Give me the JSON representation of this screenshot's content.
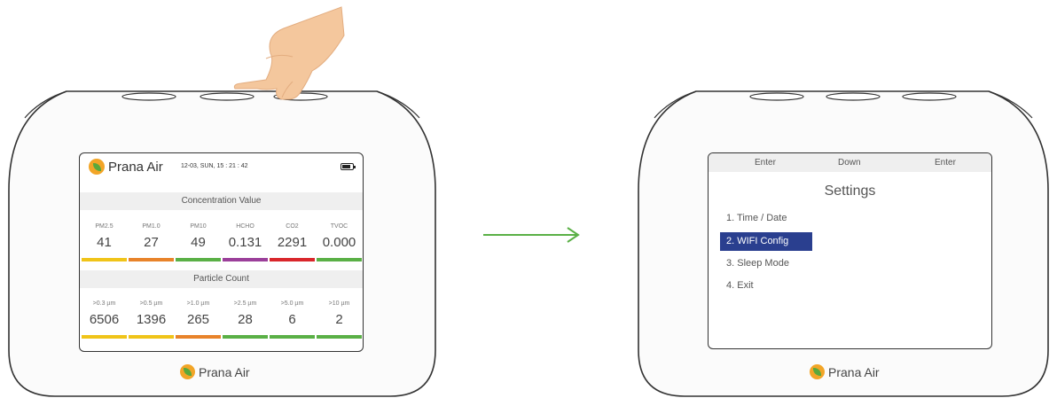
{
  "left_device": {
    "brand": "Prana Air",
    "datetime": "12-03, SUN, 15 : 21 : 42",
    "concentration_title": "Concentration Value",
    "concentration": [
      {
        "label": "PM2.5",
        "value": "41",
        "color": "#f0c419"
      },
      {
        "label": "PM1.0",
        "value": "27",
        "color": "#e8832a"
      },
      {
        "label": "PM10",
        "value": "49",
        "color": "#5ab046"
      },
      {
        "label": "HCHO",
        "value": "0.131",
        "color": "#9b3f9a"
      },
      {
        "label": "CO2",
        "value": "2291",
        "color": "#d9262b"
      },
      {
        "label": "TVOC",
        "value": "0.000",
        "color": "#5ab046"
      }
    ],
    "particle_title": "Particle Count",
    "particles": [
      {
        "label": ">0.3 µm",
        "value": "6506",
        "color": "#f0c419"
      },
      {
        "label": ">0.5 µm",
        "value": "1396",
        "color": "#f0c419"
      },
      {
        "label": ">1.0 µm",
        "value": "265",
        "color": "#e8832a"
      },
      {
        "label": ">2.5 µm",
        "value": "28",
        "color": "#5ab046"
      },
      {
        "label": ">5.0 µm",
        "value": "6",
        "color": "#5ab046"
      },
      {
        "label": ">10 µm",
        "value": "2",
        "color": "#5ab046"
      }
    ],
    "footer_brand": "Prana Air"
  },
  "right_device": {
    "top_buttons": [
      "Enter",
      "Down",
      "Enter"
    ],
    "title": "Settings",
    "menu": [
      "1. Time / Date",
      "2. WIFI Config",
      "3. Sleep Mode",
      "4. Exit"
    ],
    "selected_index": 1,
    "footer_brand": "Prana Air"
  },
  "colors": {
    "arrow": "#5ab046",
    "selection": "#2a3f8f"
  }
}
